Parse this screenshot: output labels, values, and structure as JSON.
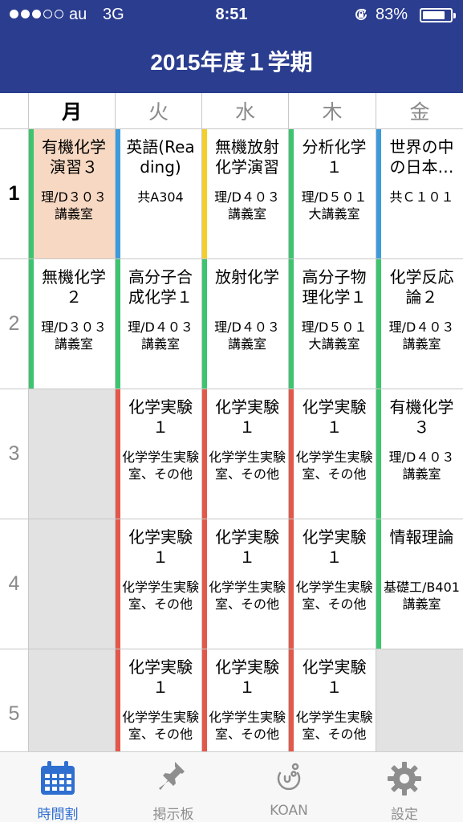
{
  "status_bar": {
    "carrier": "au",
    "network": "3G",
    "time": "8:51",
    "battery_percent": "83%",
    "battery_level": 0.83,
    "signal_bars_filled": 3,
    "signal_bars_total": 5
  },
  "header": {
    "title": "2015年度１学期"
  },
  "colors": {
    "header": "#2b3d8f",
    "green": "#3dc46f",
    "blue": "#3f9ad9",
    "yellow": "#f4cf2a",
    "red": "#e2584a",
    "highlight": "#f7d8c2",
    "empty": "#e2e2e2"
  },
  "timetable": {
    "days": [
      "月",
      "火",
      "水",
      "木",
      "金"
    ],
    "today_index": 0,
    "periods": [
      "1",
      "2",
      "3",
      "4",
      "5"
    ],
    "current_period_index": 0,
    "rows": [
      [
        {
          "name": "有機化学演習３",
          "room": "理/D３０３講義室",
          "color": "green",
          "highlight": true
        },
        {
          "name": "英語(Reading)",
          "room": "共A304",
          "color": "blue"
        },
        {
          "name": "無機放射化学演習",
          "room": "理/D４０３講義室",
          "color": "yellow"
        },
        {
          "name": "分析化学１",
          "room": "理/D５０１大講義室",
          "color": "green"
        },
        {
          "name": "世界の中の日本…",
          "room": "共Ｃ１０１",
          "color": "blue"
        }
      ],
      [
        {
          "name": "無機化学２",
          "room": "理/D３０３講義室",
          "color": "green"
        },
        {
          "name": "高分子合成化学１",
          "room": "理/D４０３講義室",
          "color": "green"
        },
        {
          "name": "放射化学",
          "room": "理/D４０３講義室",
          "color": "green"
        },
        {
          "name": "高分子物理化学１",
          "room": "理/D５０１大講義室",
          "color": "green"
        },
        {
          "name": "化学反応論２",
          "room": "理/D４０３講義室",
          "color": "green"
        }
      ],
      [
        {
          "empty": true
        },
        {
          "name": "化学実験１",
          "room": "化学学生実験室、その他",
          "color": "red"
        },
        {
          "name": "化学実験１",
          "room": "化学学生実験室、その他",
          "color": "red"
        },
        {
          "name": "化学実験１",
          "room": "化学学生実験室、その他",
          "color": "red"
        },
        {
          "name": "有機化学３",
          "room": "理/D４０３講義室",
          "color": "green"
        }
      ],
      [
        {
          "empty": true
        },
        {
          "name": "化学実験１",
          "room": "化学学生実験室、その他",
          "color": "red"
        },
        {
          "name": "化学実験１",
          "room": "化学学生実験室、その他",
          "color": "red"
        },
        {
          "name": "化学実験１",
          "room": "化学学生実験室、その他",
          "color": "red"
        },
        {
          "name": "情報理論",
          "room": "基礎工/B401講義室",
          "color": "green"
        }
      ],
      [
        {
          "empty": true
        },
        {
          "name": "化学実験１",
          "room": "化学学生実験室、その他",
          "color": "red"
        },
        {
          "name": "化学実験１",
          "room": "化学学生実験室、その他",
          "color": "red"
        },
        {
          "name": "化学実験１",
          "room": "化学学生実験室、その他",
          "color": "red"
        },
        {
          "empty": true
        }
      ]
    ]
  },
  "tabbar": {
    "active_index": 0,
    "tabs": [
      {
        "label": "時間割",
        "icon": "calendar-icon"
      },
      {
        "label": "掲示板",
        "icon": "pushpin-icon"
      },
      {
        "label": "KOAN",
        "icon": "koan-logo-icon"
      },
      {
        "label": "設定",
        "icon": "gear-icon"
      }
    ]
  }
}
